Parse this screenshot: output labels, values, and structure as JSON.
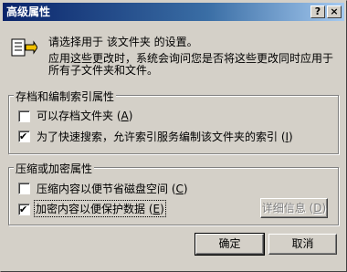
{
  "window": {
    "title": "高级属性",
    "help_label": "?",
    "close_label": "×"
  },
  "intro": {
    "line1": "请选择用于 该文件夹 的设置。",
    "line2": "应用这些更改时，系统会询问您是否将这些更改同时应用于",
    "line3": "所有子文件夹和文件。"
  },
  "archive_group": {
    "title": "存档和编制索引属性",
    "option1": {
      "label": "可以存档文件夹 (",
      "key": "A",
      "suffix": ")",
      "checked": false
    },
    "option2": {
      "label": "为了快速搜索，允许索引服务编制该文件夹的索引 (",
      "key": "I",
      "suffix": ")",
      "checked": true
    }
  },
  "compress_group": {
    "title": "压缩或加密属性",
    "option1": {
      "label": "压缩内容以便节省磁盘空间 (",
      "key": "C",
      "suffix": ")",
      "checked": false
    },
    "option2": {
      "label": "加密内容以便保护数据 (",
      "key": "E",
      "suffix": ")",
      "checked": true
    },
    "details_button": {
      "label": "详细信息 (",
      "key": "D",
      "suffix": ")"
    }
  },
  "buttons": {
    "ok": "确定",
    "cancel": "取消"
  },
  "check_glyph": "✔"
}
